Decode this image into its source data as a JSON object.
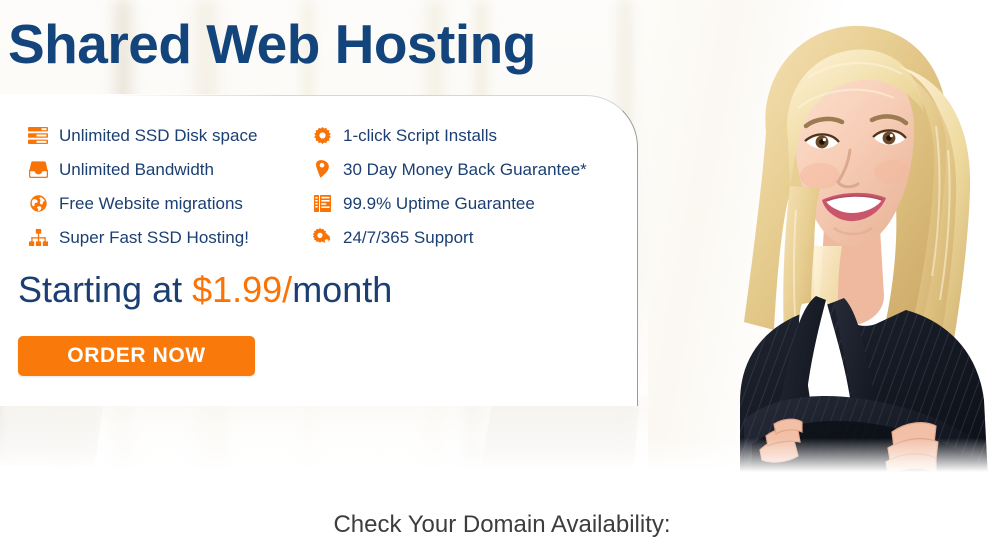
{
  "hero": {
    "headline": "Shared Web Hosting",
    "price_prefix": "Starting at ",
    "price_amount": "$1.99/",
    "price_suffix": "month",
    "order_button": "ORDER NOW",
    "domain_check_caption": "Check Your Domain Availability:"
  },
  "features": {
    "left": [
      {
        "icon": "server-icon",
        "label": "Unlimited SSD Disk space"
      },
      {
        "icon": "inbox-icon",
        "label": "Unlimited Bandwidth"
      },
      {
        "icon": "globe-icon",
        "label": "Free Website migrations"
      },
      {
        "icon": "sitemap-icon",
        "label": "Super Fast SSD Hosting!"
      }
    ],
    "right": [
      {
        "icon": "gear-icon",
        "label": "1-click Script Installs"
      },
      {
        "icon": "tag-icon",
        "label": "30 Day Money Back Guarantee*"
      },
      {
        "icon": "report-icon",
        "label": "99.9% Uptime Guarantee"
      },
      {
        "icon": "cogs-icon",
        "label": "24/7/365 Support"
      }
    ]
  },
  "photo": {
    "alt": "smiling-businesswoman-arms-crossed"
  },
  "colors": {
    "navy": "#13457c",
    "text_navy": "#1b3f72",
    "orange": "#f97306",
    "button_orange": "#f97a0b",
    "caption_gray": "#3d3d3d",
    "card_white": "#ffffff"
  }
}
